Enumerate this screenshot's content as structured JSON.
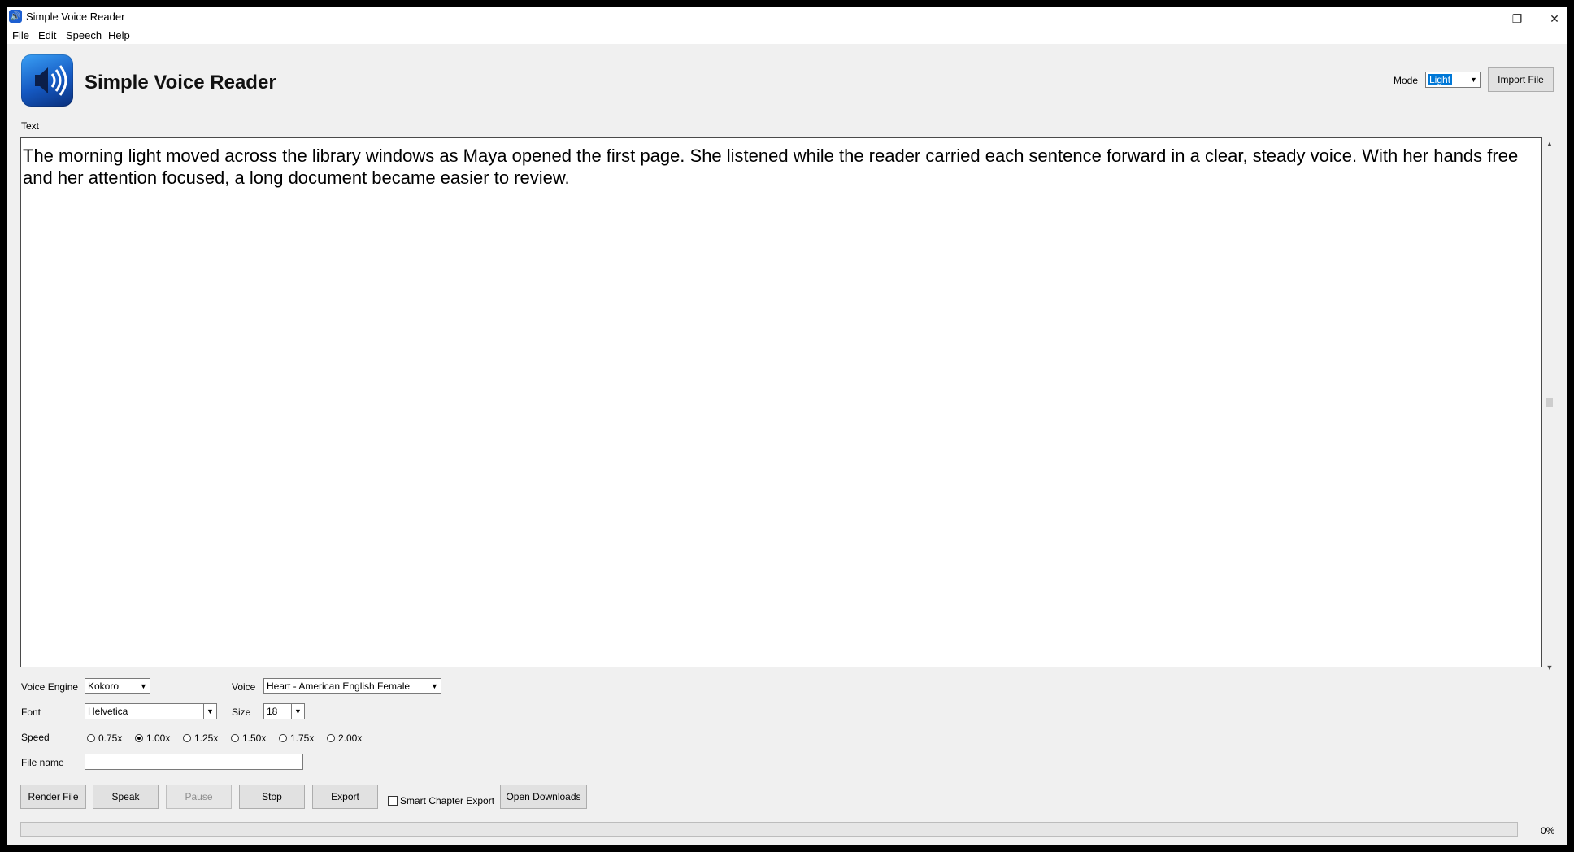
{
  "window": {
    "title": "Simple Voice Reader",
    "minimize": "—",
    "restore": "❐",
    "close": "✕"
  },
  "menu": [
    "File",
    "Edit",
    "Speech",
    "Help"
  ],
  "header": {
    "title": "Simple Voice Reader",
    "mode_label": "Mode",
    "mode_value": "Light",
    "import_label": "Import File"
  },
  "editor": {
    "label": "Text",
    "content": "The morning light moved across the library windows as Maya opened the first page. She listened while the reader carried each sentence forward in a clear, steady voice. With her hands free and her attention focused, a long document became easier to review."
  },
  "settings": {
    "voice_engine_label": "Voice Engine",
    "voice_engine_value": "Kokoro",
    "voice_label": "Voice",
    "voice_value": "Heart - American English Female",
    "font_label": "Font",
    "font_value": "Helvetica",
    "size_label": "Size",
    "size_value": "18",
    "speed_label": "Speed",
    "speed_options": [
      "0.75x",
      "1.00x",
      "1.25x",
      "1.50x",
      "1.75x",
      "2.00x"
    ],
    "speed_selected": "1.00x",
    "filename_label": "File name",
    "filename_value": ""
  },
  "actions": {
    "render": "Render File",
    "speak": "Speak",
    "pause": "Pause",
    "stop": "Stop",
    "export": "Export",
    "smart_chapter": "Smart Chapter Export",
    "open_downloads": "Open Downloads"
  },
  "progress": {
    "value": 0,
    "label": "0%"
  }
}
